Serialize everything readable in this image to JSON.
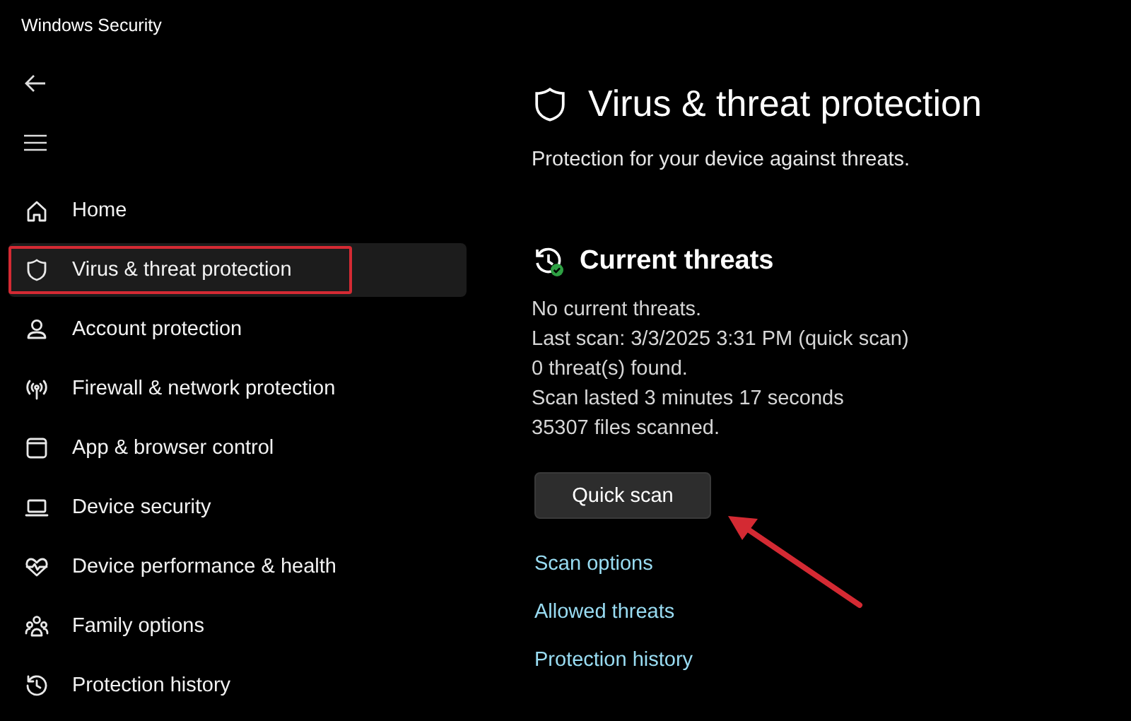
{
  "window": {
    "title": "Windows Security"
  },
  "sidebar": {
    "items": [
      {
        "label": "Home",
        "selected": false,
        "highlighted": false
      },
      {
        "label": "Virus & threat protection",
        "selected": true,
        "highlighted": true
      },
      {
        "label": "Account protection",
        "selected": false,
        "highlighted": false
      },
      {
        "label": "Firewall & network protection",
        "selected": false,
        "highlighted": false
      },
      {
        "label": "App & browser control",
        "selected": false,
        "highlighted": false
      },
      {
        "label": "Device security",
        "selected": false,
        "highlighted": false
      },
      {
        "label": "Device performance & health",
        "selected": false,
        "highlighted": false
      },
      {
        "label": "Family options",
        "selected": false,
        "highlighted": false
      },
      {
        "label": "Protection history",
        "selected": false,
        "highlighted": false
      }
    ]
  },
  "page": {
    "title": "Virus & threat protection",
    "subtitle": "Protection for your device against threats."
  },
  "current_threats": {
    "heading": "Current threats",
    "lines": [
      "No current threats.",
      "Last scan: 3/3/2025 3:31 PM (quick scan)",
      "0 threat(s) found.",
      "Scan lasted 3 minutes 17 seconds",
      "35307 files scanned."
    ],
    "button": {
      "label": "Quick scan",
      "pointed_at": true
    },
    "links": [
      "Scan options",
      "Allowed threats",
      "Protection history"
    ]
  }
}
